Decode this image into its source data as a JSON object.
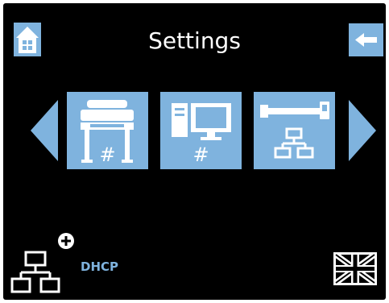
{
  "header": {
    "title": "Settings",
    "home_icon": "home-icon",
    "back_icon": "back-arrow-icon"
  },
  "carousel": {
    "prev_icon": "chevron-left-icon",
    "next_icon": "chevron-right-icon",
    "items": [
      {
        "icon": "printer-icon",
        "label": "#"
      },
      {
        "icon": "computer-icon",
        "label": "#"
      },
      {
        "icon": "network-icon",
        "label": ""
      }
    ]
  },
  "footer": {
    "network_icon": "network-add-icon",
    "dhcp_label": "DHCP",
    "language_icon": "uk-flag-icon"
  },
  "colors": {
    "background": "#000000",
    "accent": "#7fb3de",
    "text": "#ffffff"
  }
}
